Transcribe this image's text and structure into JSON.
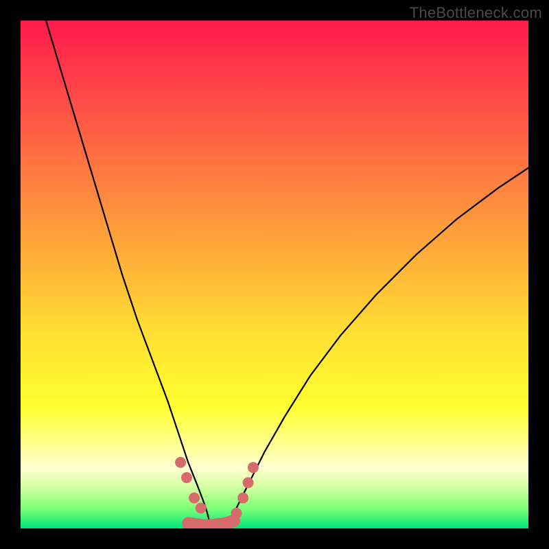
{
  "watermark": "TheBottleneck.com",
  "colors": {
    "frame": "#000000",
    "curve": "#000000",
    "markers": "#d76a6a",
    "gradient_top": "#ff1a4b",
    "gradient_bottom": "#00e57a"
  },
  "chart_data": {
    "type": "line",
    "title": "",
    "xlabel": "",
    "ylabel": "",
    "xlim": [
      0,
      100
    ],
    "ylim": [
      0,
      100
    ],
    "grid": false,
    "legend": false,
    "series": [
      {
        "name": "left-curve",
        "x": [
          5,
          8,
          11,
          14,
          17,
          20,
          23,
          26,
          29,
          31,
          33,
          35,
          36.5,
          37.3
        ],
        "y": [
          100,
          90,
          80,
          70,
          60,
          50,
          41,
          33,
          25,
          19,
          13,
          8,
          4,
          1
        ]
      },
      {
        "name": "right-curve",
        "x": [
          41.2,
          42.5,
          45,
          48,
          52,
          57,
          63,
          70,
          78,
          86,
          94,
          100
        ],
        "y": [
          1,
          4,
          9,
          15,
          22,
          30,
          38,
          46,
          54,
          61,
          67,
          71
        ]
      },
      {
        "name": "valley-band",
        "x": [
          33,
          34.5,
          36,
          37.5,
          39,
          40.5,
          42
        ],
        "y": [
          1,
          0.8,
          0.6,
          0.6,
          0.8,
          1,
          1.5
        ]
      },
      {
        "name": "marker-dots",
        "x": [
          31.5,
          32.7,
          34.2,
          35.5,
          42.5,
          43.8,
          44.8,
          45.8
        ],
        "y": [
          13,
          10,
          6,
          4,
          3,
          6,
          9,
          12
        ]
      }
    ]
  }
}
